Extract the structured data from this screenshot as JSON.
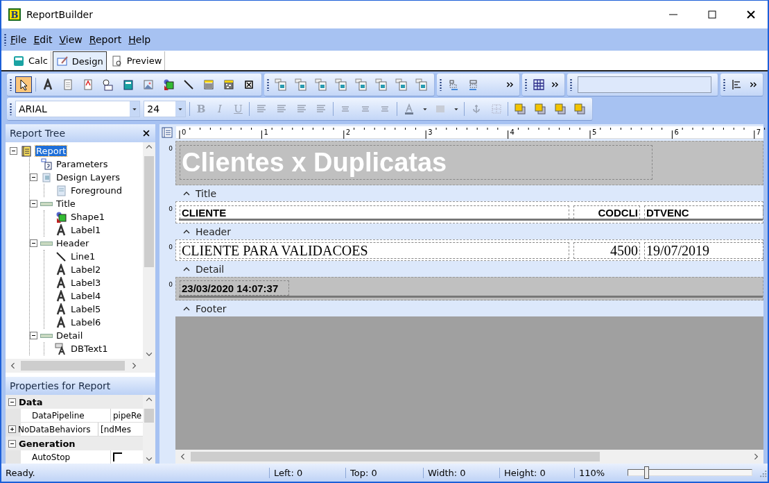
{
  "window": {
    "title": "ReportBuilder",
    "icon_letter": "B"
  },
  "menu": [
    "File",
    "Edit",
    "View",
    "Report",
    "Help"
  ],
  "tabs": [
    {
      "label": "Calc",
      "selected": false
    },
    {
      "label": "Design",
      "selected": true
    },
    {
      "label": "Preview",
      "selected": false
    }
  ],
  "toolbar": {
    "pointer_selected": true,
    "font": "ARIAL",
    "font_size": "24",
    "style_buttons": [
      {
        "label": "B",
        "kind": "bold",
        "disabled": true
      },
      {
        "label": "I",
        "kind": "italic",
        "disabled": true
      },
      {
        "label": "U",
        "kind": "underline",
        "disabled": true
      }
    ]
  },
  "report_tree": {
    "title": "Report Tree",
    "items": [
      {
        "label": "Report",
        "kind": "report",
        "selected": true,
        "expanded": true,
        "children": [
          {
            "label": "Parameters",
            "kind": "parameters",
            "selected": false
          },
          {
            "label": "Design Layers",
            "kind": "layers",
            "selected": false,
            "expanded": true,
            "children": [
              {
                "label": "Foreground",
                "kind": "page",
                "selected": false
              }
            ]
          },
          {
            "label": "Title",
            "kind": "band",
            "selected": false,
            "expanded": true,
            "children": [
              {
                "label": "Shape1",
                "kind": "shape",
                "selected": false
              },
              {
                "label": "Label1",
                "kind": "label",
                "selected": false
              }
            ]
          },
          {
            "label": "Header",
            "kind": "band",
            "selected": false,
            "expanded": true,
            "children": [
              {
                "label": "Line1",
                "kind": "line",
                "selected": false
              },
              {
                "label": "Label2",
                "kind": "label",
                "selected": false
              },
              {
                "label": "Label3",
                "kind": "label",
                "selected": false
              },
              {
                "label": "Label4",
                "kind": "label",
                "selected": false
              },
              {
                "label": "Label5",
                "kind": "label",
                "selected": false
              },
              {
                "label": "Label6",
                "kind": "label",
                "selected": false
              }
            ]
          },
          {
            "label": "Detail",
            "kind": "band",
            "selected": false,
            "expanded": true,
            "children": [
              {
                "label": "DBText1",
                "kind": "dbtext",
                "selected": false
              }
            ]
          }
        ]
      }
    ]
  },
  "properties": {
    "title": "Properties for Report",
    "categories": [
      {
        "name": "Data",
        "expanded": true,
        "rows": [
          {
            "name": "DataPipeline",
            "kind": "text",
            "value": "pipeRe"
          },
          {
            "name": "NoDataBehaviors",
            "kind": "group",
            "value": "[ndMes"
          }
        ]
      },
      {
        "name": "Generation",
        "expanded": true,
        "rows": [
          {
            "name": "AutoStop",
            "kind": "checkbox",
            "checked": false
          }
        ]
      }
    ]
  },
  "designer": {
    "ruler_marks": [
      "0",
      "1",
      "2",
      "3",
      "4",
      "5",
      "6",
      "7"
    ],
    "bands": [
      {
        "name": "Title",
        "kind": "title",
        "shaded": true,
        "ruler": "0",
        "items": [
          {
            "text": "Clientes x Duplicatas"
          }
        ]
      },
      {
        "name": "Header",
        "kind": "header",
        "shaded": false,
        "ruler": "0",
        "items": [
          {
            "text": "CLIENTE"
          },
          {
            "text": "CODCLI"
          },
          {
            "text": "DTVENC"
          }
        ]
      },
      {
        "name": "Detail",
        "kind": "detail",
        "shaded": false,
        "ruler": "0",
        "items": [
          {
            "text": "CLIENTE PARA VALIDACOES"
          },
          {
            "text": "4500"
          },
          {
            "text": "19/07/2019"
          }
        ]
      },
      {
        "name": "Footer",
        "kind": "footer",
        "shaded": true,
        "ruler": "0",
        "items": [
          {
            "text": "23/03/2020 14:07:37"
          }
        ]
      }
    ]
  },
  "status_bar": {
    "message": "Ready.",
    "fields": [
      "Left: 0",
      "Top: 0",
      "Width: 0",
      "Height: 0"
    ],
    "zoom": "110%",
    "zoom_slider": {
      "level": 0.13
    }
  }
}
